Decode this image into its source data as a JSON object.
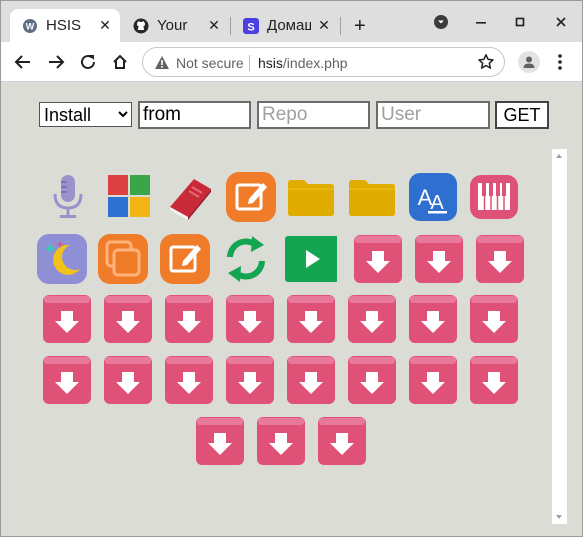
{
  "browser": {
    "tabs": [
      {
        "title": "HSIS",
        "active": true
      },
      {
        "title": "Your R",
        "active": false
      },
      {
        "title": "Домаш",
        "active": false
      }
    ],
    "new_tab_label": "+",
    "address": {
      "security_label": "Not secure",
      "host": "hsis",
      "path": "/index.php"
    }
  },
  "form": {
    "action_selected": "Install",
    "action_options": [
      "Install"
    ],
    "from_value": "from",
    "repo_placeholder": "Repo",
    "user_placeholder": "User",
    "submit_label": "GET"
  },
  "apps": [
    "microphone-app-icon",
    "windows-logo-app-icon",
    "book-app-icon",
    "edit-app-icon",
    "folder-app-icon",
    "folder-app-icon",
    "font-app-icon",
    "piano-app-icon",
    "night-mode-app-icon",
    "copy-app-icon",
    "edit-app-icon",
    "refresh-app-icon",
    "play-app-icon",
    "download-app-icon"
  ],
  "colors": {
    "download": "#e05178",
    "orange": "#f07c2a",
    "folder": "#e0ac00",
    "blue": "#2f6fd0",
    "green": "#13a551",
    "book": "#d63341"
  }
}
